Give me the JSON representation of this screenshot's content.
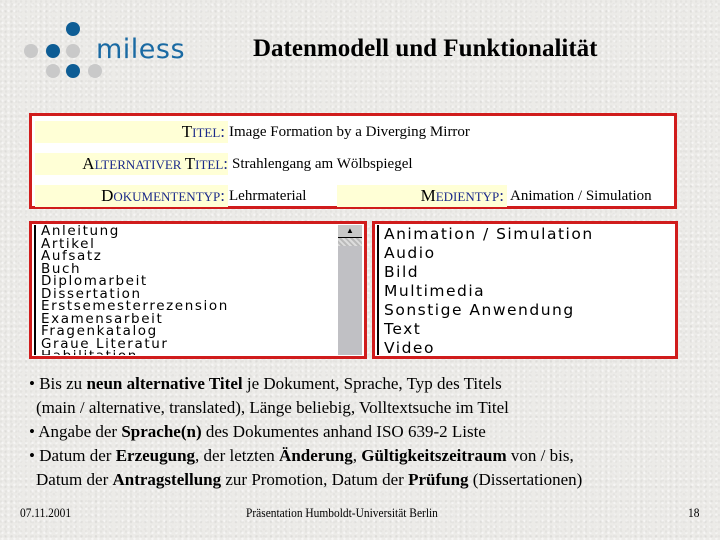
{
  "logo": {
    "text": "miless",
    "colors": {
      "blue": "#0e5d95",
      "grey": "#c9c9c9"
    }
  },
  "slide": {
    "title": "Datenmodell und Funktionalität"
  },
  "metadata_form": {
    "fields": [
      {
        "label_initial": "T",
        "label_rest": "ITEL",
        "value": "Image Formation by a Diverging Mirror"
      },
      {
        "label_initial": "A",
        "label_rest": "LTERNATIVER ",
        "label_initial2": "T",
        "label_rest2": "ITEL",
        "value": "Strahlengang am Wölbspiegel"
      },
      {
        "label_initial": "D",
        "label_rest": "OKUMENTENTYP",
        "value": "Lehrmaterial"
      },
      {
        "label_initial": "M",
        "label_rest": "EDIENTYP",
        "value": "Animation / Simulation"
      }
    ],
    "colon": ":"
  },
  "document_type_list": {
    "items": [
      "Anleitung",
      "Artikel",
      "Aufsatz",
      "Buch",
      "Diplomarbeit",
      "Dissertation",
      "Erstsemesterrezension",
      "Examensarbeit",
      "Fragenkatalog",
      "Graue Literatur",
      "Habilitation"
    ],
    "scroll_up_glyph": "▲"
  },
  "media_type_list": {
    "items": [
      "Animation / Simulation",
      "Audio",
      "Bild",
      "Multimedia",
      "Sonstige Anwendung",
      "Text",
      "Video"
    ]
  },
  "bullets": {
    "b1": {
      "pre": "• Bis zu ",
      "bold": "neun alternative Titel",
      "post": " je Dokument, Sprache, Typ des Titels",
      "line2": "(main / alternative, translated), Länge beliebig, Volltextsuche im Titel"
    },
    "b2": {
      "pre": "• Angabe der ",
      "bold": "Sprache(n)",
      "post": " des Dokumentes anhand ISO 639-2 Liste"
    },
    "b3": {
      "pre": "• Datum der ",
      "bold1": "Erzeugung",
      "mid1": ", der letzten ",
      "bold2": "Änderung",
      "mid2": ", ",
      "bold3": "Gültigkeitszeitraum",
      "post": " von / bis,",
      "l2_pre": "Datum der ",
      "l2_bold1": "Antragstellung",
      "l2_mid": " zur Promotion, Datum der ",
      "l2_bold2": "Prüfung",
      "l2_post": " (Dissertationen)"
    }
  },
  "footer": {
    "date": "07.11.2001",
    "center": "Präsentation Humboldt-Universität Berlin",
    "page": "18"
  }
}
